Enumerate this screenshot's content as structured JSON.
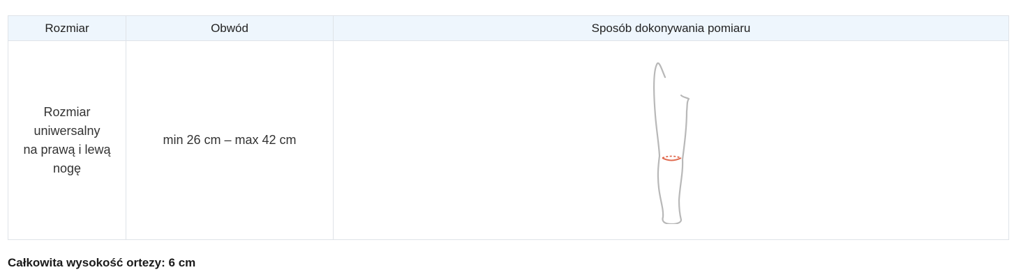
{
  "table": {
    "headers": {
      "size": "Rozmiar",
      "circumference": "Obwód",
      "method": "Sposób dokonywania pomiaru"
    },
    "rows": [
      {
        "size": "Rozmiar\nuniwersalny\nna prawą i lewą\nnogę",
        "circumference": "min 26 cm – max 42 cm",
        "method_icon": "leg-knee-measurement-icon"
      }
    ]
  },
  "footer": {
    "total_height": "Całkowita wysokość ortezy: 6 cm"
  },
  "colors": {
    "header_background": "#eef6fd",
    "border": "#dfe3e8",
    "leg_outline": "#b8b8b8",
    "measure_line": "#e06a4f"
  }
}
